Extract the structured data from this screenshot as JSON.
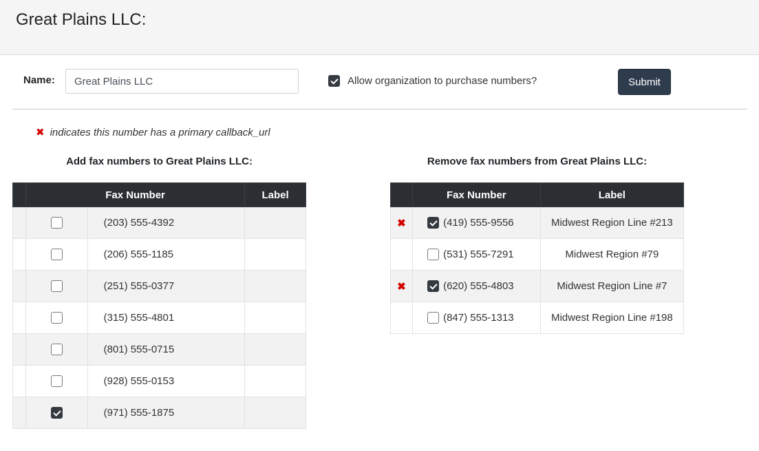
{
  "header": {
    "title": "Great Plains LLC:"
  },
  "form": {
    "name_label": "Name:",
    "name_value": "Great Plains LLC",
    "allow_label": "Allow organization to purchase numbers?",
    "allow_checked": true,
    "submit_label": "Submit"
  },
  "legend": {
    "text": "indicates this number has a primary callback_url"
  },
  "add_section": {
    "title": "Add fax numbers to Great Plains LLC:",
    "columns": [
      "Fax Number",
      "Label"
    ],
    "rows": [
      {
        "number": "(203) 555-4392",
        "label": "",
        "checked": false
      },
      {
        "number": "(206) 555-1185",
        "label": "",
        "checked": false
      },
      {
        "number": "(251) 555-0377",
        "label": "",
        "checked": false
      },
      {
        "number": "(315) 555-4801",
        "label": "",
        "checked": false
      },
      {
        "number": "(801) 555-0715",
        "label": "",
        "checked": false
      },
      {
        "number": "(928) 555-0153",
        "label": "",
        "checked": false
      },
      {
        "number": "(971) 555-1875",
        "label": "",
        "checked": true
      }
    ]
  },
  "remove_section": {
    "title": "Remove fax numbers from Great Plains LLC:",
    "columns": [
      "Fax Number",
      "Label"
    ],
    "rows": [
      {
        "number": "(419) 555-9556",
        "label": "Midwest Region Line #213",
        "checked": true,
        "primary_callback": true
      },
      {
        "number": "(531) 555-7291",
        "label": "Midwest Region #79",
        "checked": false,
        "primary_callback": false
      },
      {
        "number": "(620) 555-4803",
        "label": "Midwest Region Line #7",
        "checked": true,
        "primary_callback": true
      },
      {
        "number": "(847) 555-1313",
        "label": "Midwest Region Line #198",
        "checked": false,
        "primary_callback": false
      }
    ]
  },
  "icons": {
    "primary_callback": "x-mark-icon",
    "checkbox": "checkbox-icon"
  },
  "colors": {
    "x_mark": "#d40000",
    "header_dark": "#2b2e33",
    "button": "#2f3c4e"
  }
}
